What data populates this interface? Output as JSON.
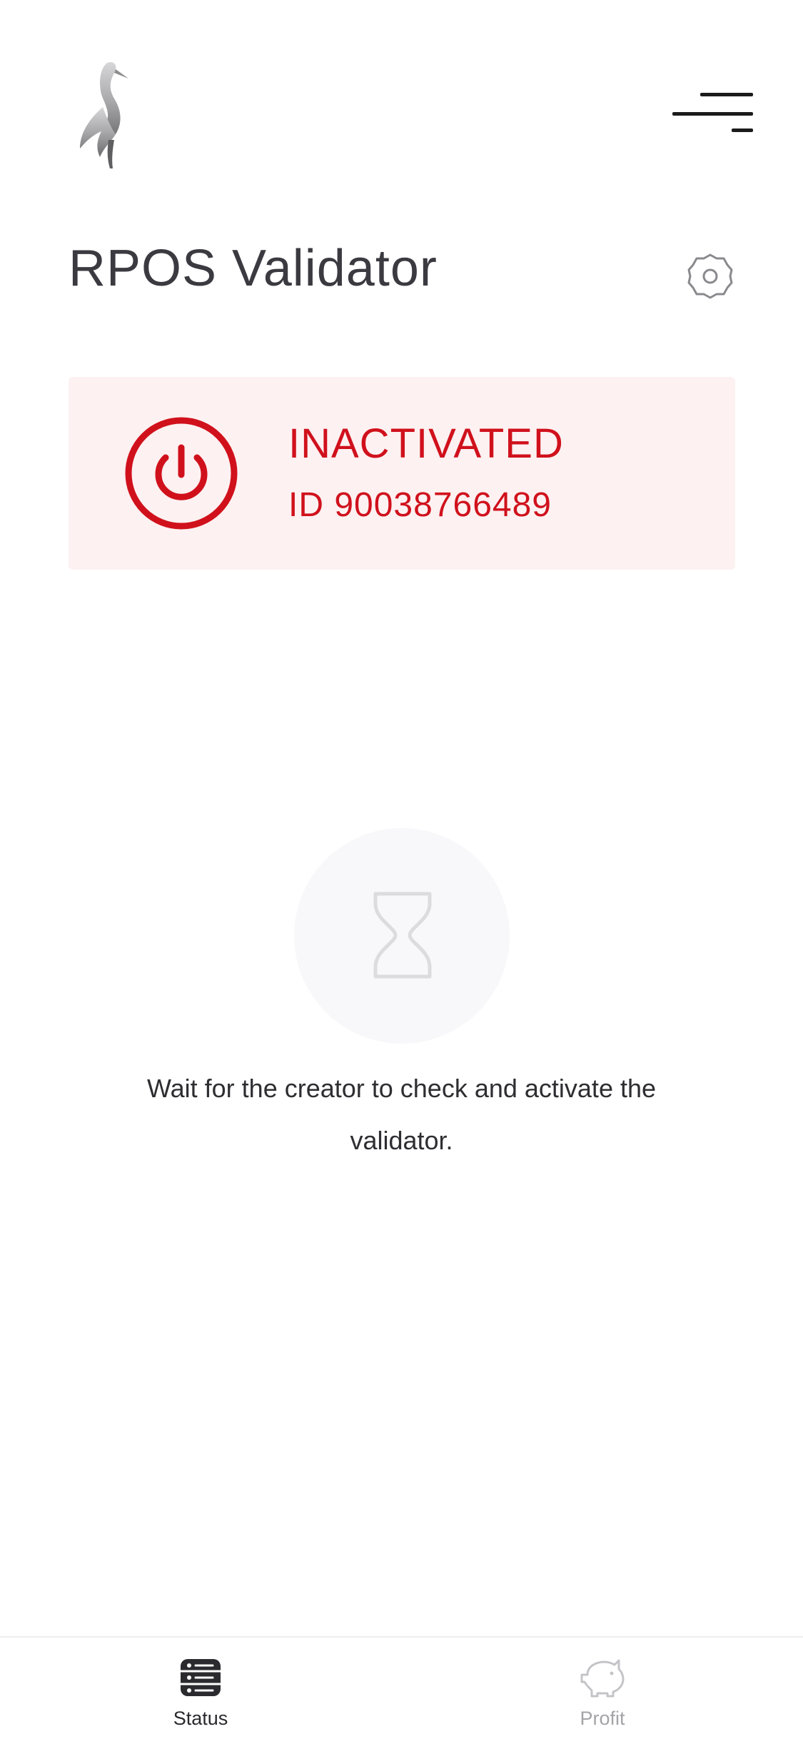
{
  "header": {
    "logo_icon": "crane-bird-logo",
    "menu_icon": "hamburger-menu-icon"
  },
  "page": {
    "title": "RPOS Validator",
    "settings_icon": "gear-icon"
  },
  "status_card": {
    "icon": "power-icon",
    "status": "INACTIVATED",
    "id_text": "ID 90038766489",
    "accent_color": "#d0111c",
    "background_color": "#fdf1f1"
  },
  "waiting": {
    "icon": "hourglass-icon",
    "message": "Wait for the creator to check and activate the validator."
  },
  "tab_bar": {
    "tabs": [
      {
        "label": "Status",
        "icon": "server-list-icon",
        "active": true
      },
      {
        "label": "Profit",
        "icon": "piggy-bank-icon",
        "active": false
      }
    ]
  }
}
